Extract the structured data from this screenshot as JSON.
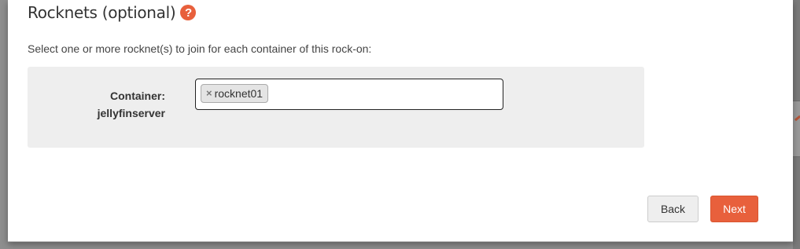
{
  "dialog": {
    "title": "Rocknets (optional)",
    "help_icon": "?",
    "description": "Select one or more rocknet(s) to join for each container of this rock-on:"
  },
  "container": {
    "label_prefix": "Container:",
    "name": "jellyfinserver",
    "selected_rocknets": [
      {
        "remove_symbol": "×",
        "label": "rocknet01"
      }
    ]
  },
  "buttons": {
    "back_label": "Back",
    "next_label": "Next"
  },
  "colors": {
    "accent": "#e8603c",
    "panel_bg": "#eeeeee"
  },
  "icons": {
    "help": "question-circle-icon",
    "tag_remove": "close-icon"
  }
}
